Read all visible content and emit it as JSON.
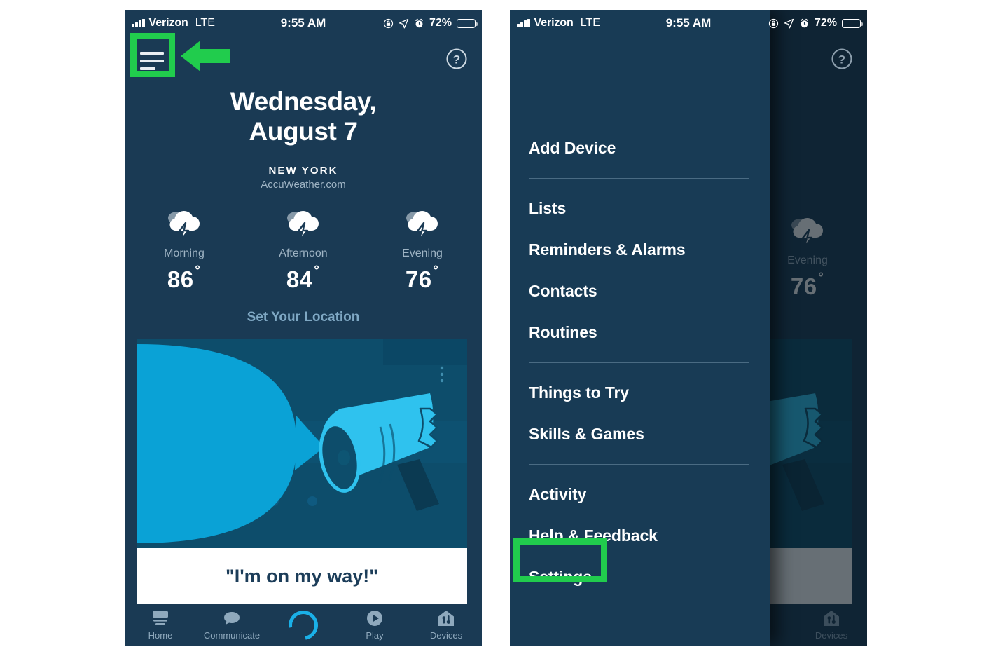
{
  "theme": {
    "phone_bg": "#1a3a54",
    "drawer_bg": "#183b55",
    "accent_cyan": "#1ab0e8",
    "highlight_green": "#21cc4d",
    "muted_text": "#9fb4c4",
    "card_bg": "#0d4d6b",
    "caption_text": "#1c3d59"
  },
  "status_bar": {
    "carrier": "Verizon",
    "network": "LTE",
    "time": "9:55 AM",
    "battery_percent": "72%",
    "icons": [
      "signal-bars-icon",
      "lock-rotation-icon",
      "location-arrow-icon",
      "alarm-clock-icon",
      "battery-icon"
    ]
  },
  "left_screen": {
    "name": "alexa-home-screen",
    "top_bar": {
      "menu_button_name": "hamburger-menu-button",
      "help_button_name": "help-button",
      "help_glyph": "?"
    },
    "weather": {
      "date_line1": "Wednesday,",
      "date_line2": "August 7",
      "city": "NEW YORK",
      "source": "AccuWeather.com",
      "periods": [
        {
          "label": "Morning",
          "temp": "86",
          "degree": "˚",
          "icon": "thunderstorm-cloud-icon"
        },
        {
          "label": "Afternoon",
          "temp": "84",
          "degree": "˚",
          "icon": "thunderstorm-cloud-icon"
        },
        {
          "label": "Evening",
          "temp": "76",
          "degree": "˚",
          "icon": "thunderstorm-cloud-icon"
        }
      ],
      "set_location_link": "Set Your Location"
    },
    "card": {
      "illustration": "megaphone-speech-bubble-illustration",
      "caption": "\"I'm on my way!\""
    },
    "bottom_nav": [
      {
        "label": "Home",
        "icon": "home-icon",
        "active": true
      },
      {
        "label": "Communicate",
        "icon": "chat-bubble-icon",
        "active": false
      },
      {
        "label": "",
        "icon": "alexa-ring-icon",
        "active": false
      },
      {
        "label": "Play",
        "icon": "play-circle-icon",
        "active": false
      },
      {
        "label": "Devices",
        "icon": "devices-home-icon",
        "active": false
      }
    ]
  },
  "right_screen": {
    "name": "alexa-side-drawer-open",
    "help_glyph": "?",
    "drawer_menu": [
      {
        "label": "Add Device",
        "separator_after": true
      },
      {
        "label": "Lists",
        "separator_after": false
      },
      {
        "label": "Reminders & Alarms",
        "separator_after": false
      },
      {
        "label": "Contacts",
        "separator_after": false
      },
      {
        "label": "Routines",
        "separator_after": true
      },
      {
        "label": "Things to Try",
        "separator_after": false
      },
      {
        "label": "Skills & Games",
        "separator_after": true
      },
      {
        "label": "Activity",
        "separator_after": false
      },
      {
        "label": "Help & Feedback",
        "separator_after": false
      },
      {
        "label": "Settings",
        "separator_after": false
      }
    ],
    "dimmed_background": {
      "weather_period_label": "Evening",
      "weather_temp": "76",
      "degree": "˚",
      "nav_label": "Devices",
      "caption_fragment": "\""
    }
  },
  "annotations": [
    {
      "name": "hamburger-highlight-box",
      "target": "hamburger-menu-button",
      "color": "#21cc4d"
    },
    {
      "name": "pointer-arrow",
      "direction": "left",
      "color": "#21cc4d"
    },
    {
      "name": "settings-highlight-box",
      "target": "drawer-item-settings",
      "color": "#21cc4d"
    }
  ]
}
